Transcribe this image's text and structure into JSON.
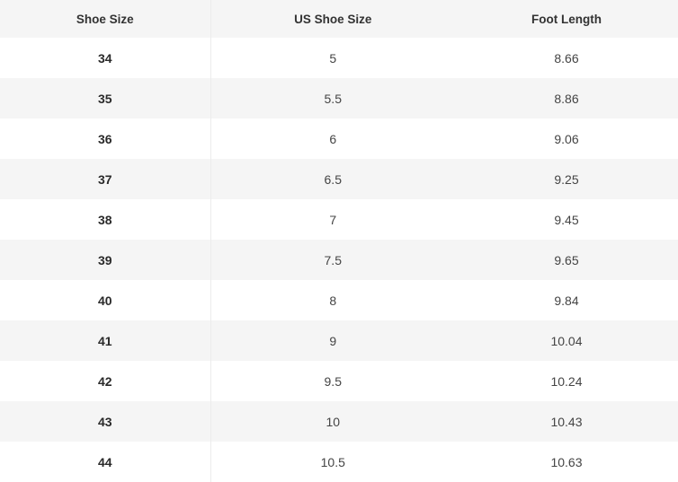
{
  "table": {
    "headers": [
      "Shoe Size",
      "US Shoe Size",
      "Foot Length"
    ],
    "rows": [
      [
        "34",
        "5",
        "8.66"
      ],
      [
        "35",
        "5.5",
        "8.86"
      ],
      [
        "36",
        "6",
        "9.06"
      ],
      [
        "37",
        "6.5",
        "9.25"
      ],
      [
        "38",
        "7",
        "9.45"
      ],
      [
        "39",
        "7.5",
        "9.65"
      ],
      [
        "40",
        "8",
        "9.84"
      ],
      [
        "41",
        "9",
        "10.04"
      ],
      [
        "42",
        "9.5",
        "10.24"
      ],
      [
        "43",
        "10",
        "10.43"
      ],
      [
        "44",
        "10.5",
        "10.63"
      ]
    ]
  },
  "colors": {
    "header_bg": "#f5f5f5",
    "stripe_bg": "#f5f5f5",
    "row_bg": "#ffffff",
    "text": "#333333"
  }
}
